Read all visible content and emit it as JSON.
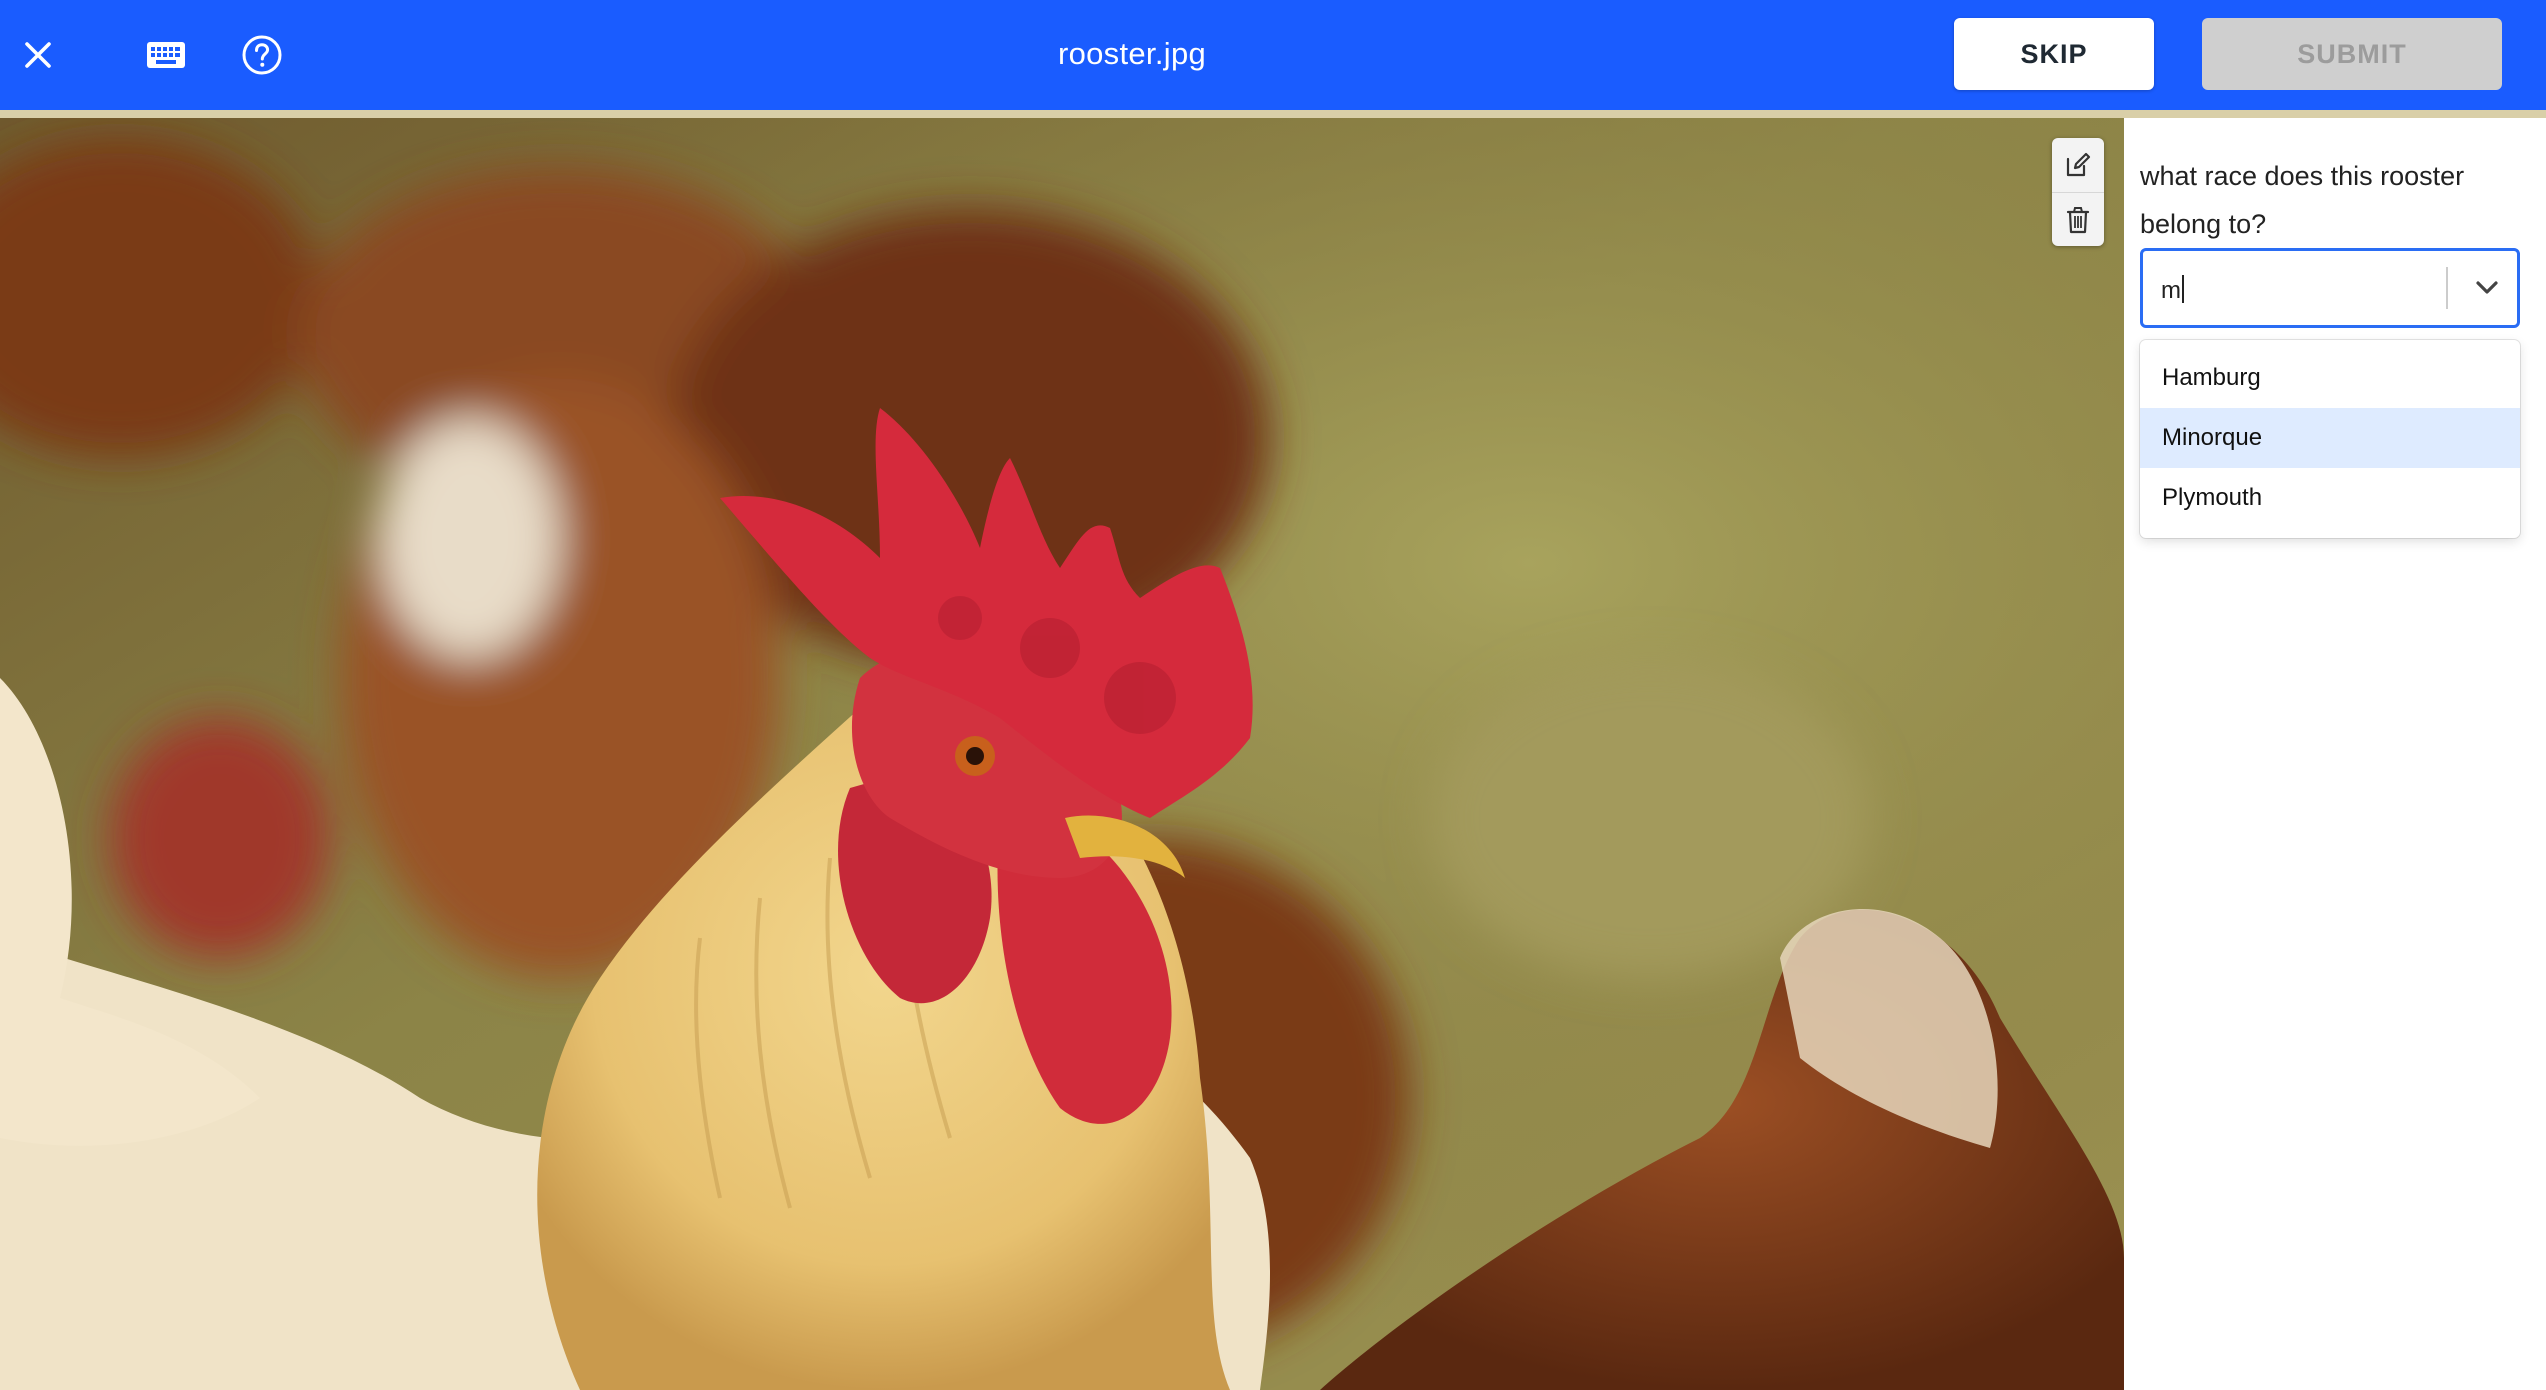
{
  "header": {
    "title": "rooster.jpg",
    "close_icon": "close-icon",
    "keyboard_icon": "keyboard-icon",
    "help_icon": "help-icon",
    "skip_label": "SKIP",
    "submit_label": "SUBMIT",
    "bar_color": "#1a5cff",
    "accent_color": "#d9cfa8"
  },
  "image": {
    "subject": "rooster photo",
    "tools": {
      "edit_icon": "edit-icon",
      "delete_icon": "trash-icon"
    }
  },
  "panel": {
    "question": "what race does this rooster belong to?",
    "select": {
      "value": "m",
      "chevron_icon": "chevron-down-icon",
      "options": [
        {
          "label": "Hamburg",
          "highlighted": false
        },
        {
          "label": "Minorque",
          "highlighted": true
        },
        {
          "label": "Plymouth",
          "highlighted": false
        }
      ]
    },
    "focus_color": "#2a6df4",
    "highlight_color": "#deebff"
  }
}
